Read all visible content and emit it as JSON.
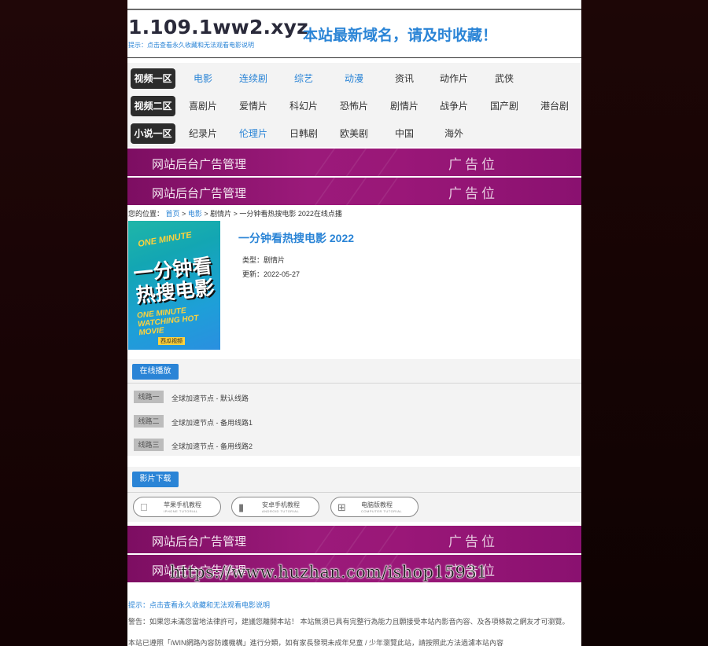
{
  "site": {
    "domain": "1.109.1ww2.xyz",
    "slogan": "本站最新域名，请及时收藏！",
    "tip_top": "提示：点击查看永久收藏和无法观看电影说明"
  },
  "nav": {
    "rows": [
      {
        "tag": "视频一区",
        "links": [
          {
            "label": "电影",
            "highlight": true
          },
          {
            "label": "连续剧",
            "highlight": true
          },
          {
            "label": "综艺",
            "highlight": true
          },
          {
            "label": "动漫",
            "highlight": true
          },
          {
            "label": "资讯",
            "highlight": false
          },
          {
            "label": "动作片",
            "highlight": false
          },
          {
            "label": "武侠",
            "highlight": false
          }
        ]
      },
      {
        "tag": "视频二区",
        "links": [
          {
            "label": "喜剧片",
            "highlight": false
          },
          {
            "label": "爱情片",
            "highlight": false
          },
          {
            "label": "科幻片",
            "highlight": false
          },
          {
            "label": "恐怖片",
            "highlight": false
          },
          {
            "label": "剧情片",
            "highlight": false
          },
          {
            "label": "战争片",
            "highlight": false
          },
          {
            "label": "国产剧",
            "highlight": false
          },
          {
            "label": "港台剧",
            "highlight": false
          }
        ]
      },
      {
        "tag": "小说一区",
        "links": [
          {
            "label": "纪录片",
            "highlight": false
          },
          {
            "label": "伦理片",
            "highlight": true
          },
          {
            "label": "日韩剧",
            "highlight": false
          },
          {
            "label": "欧美剧",
            "highlight": false
          },
          {
            "label": "中国",
            "highlight": false
          },
          {
            "label": "海外",
            "highlight": false
          }
        ]
      }
    ]
  },
  "ads": {
    "left": "网站后台广告管理",
    "right": "广告位"
  },
  "breadcrumb": {
    "prefix": "您的位置：",
    "home": "首页",
    "sep": " > ",
    "category": "电影",
    "sub": "剧情片",
    "current": "一分钟看热搜电影 2022在线点播"
  },
  "poster": {
    "line1": "ONE MINUTE",
    "line2": "一分钟看热搜电影",
    "line3": "ONE MINUTE WATCHING HOT MOVIE",
    "badge": "西瓜视频"
  },
  "movie": {
    "title": "一分钟看热搜电影 2022",
    "type_label": "类型：",
    "type_value": "剧情片",
    "date_label": "更新：",
    "date_value": "2022-05-27"
  },
  "play": {
    "heading": "在线播放",
    "lines": [
      {
        "tag": "线路一",
        "text": "全球加速节点 - 默认线路"
      },
      {
        "tag": "线路二",
        "text": "全球加速节点 - 备用线路1"
      },
      {
        "tag": "线路三",
        "text": "全球加速节点 - 备用线路2"
      }
    ]
  },
  "download": {
    "heading": "影片下载",
    "buttons": [
      {
        "icon": "apple-icon",
        "label": "苹果手机教程",
        "sub": "IPHONE TUTORIAL"
      },
      {
        "icon": "android-icon",
        "label": "安卓手机教程",
        "sub": "ANDROID TUTORIAL"
      },
      {
        "icon": "windows-icon",
        "label": "电脑版教程",
        "sub": "COMPUTER TUTORIAL"
      }
    ]
  },
  "watermark": "https://www.huzhan.com/ishop15931",
  "footer": {
    "tip": "提示：点击查看永久收藏和无法观看电影说明",
    "warning": "警告：如果您未滿您當地法律許可，建議您離開本站！ 本站無須已具有完整行為能力且願接受本站內影音內容、及各項條款之網友才可瀏覽。",
    "grading": "本站已遵照「iWIN網路內容防護機構」進行分類，如有家長發現未成年兒童 / 少年瀏覽此站，請按照此方法過濾本站內容"
  },
  "colors": {
    "accent": "#2a84d6",
    "ad_bg": "#9b1a7a",
    "nav_tag_bg": "#2c2c2c"
  }
}
